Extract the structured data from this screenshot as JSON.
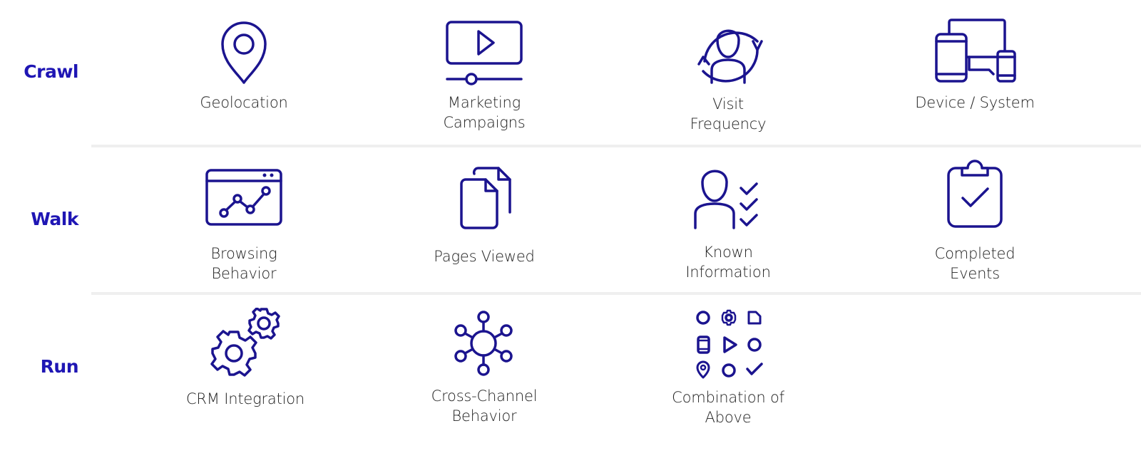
{
  "accent_color": "#1f16b4",
  "icon_color": "#1b148f",
  "rows": [
    {
      "label": "Crawl",
      "items": [
        {
          "icon": "map-pin-icon",
          "caption": "Geolocation"
        },
        {
          "icon": "video-player-icon",
          "caption": "Marketing\nCampaigns"
        },
        {
          "icon": "user-cycle-icon",
          "caption": "Visit\nFrequency"
        },
        {
          "icon": "devices-icon",
          "caption": "Device / System"
        }
      ]
    },
    {
      "label": "Walk",
      "items": [
        {
          "icon": "browser-chart-icon",
          "caption": "Browsing\nBehavior"
        },
        {
          "icon": "documents-icon",
          "caption": "Pages Viewed"
        },
        {
          "icon": "user-checklist-icon",
          "caption": "Known\nInformation"
        },
        {
          "icon": "clipboard-check-icon",
          "caption": "Completed\nEvents"
        }
      ]
    },
    {
      "label": "Run",
      "items": [
        {
          "icon": "gears-icon",
          "caption": "CRM Integration"
        },
        {
          "icon": "network-hub-icon",
          "caption": "Cross-Channel\nBehavior"
        },
        {
          "icon": "icon-grid-icon",
          "caption": "Combination of\nAbove"
        }
      ]
    }
  ]
}
